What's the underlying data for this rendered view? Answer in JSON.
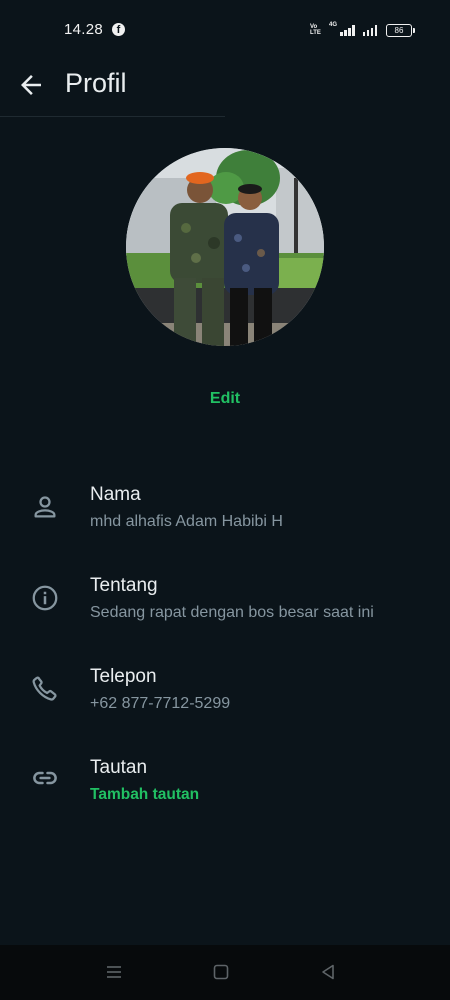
{
  "status_bar": {
    "time": "14.28",
    "network": "4G",
    "volte": "Vo LTE",
    "battery": "86"
  },
  "header": {
    "title": "Profil"
  },
  "profile": {
    "edit_label": "Edit"
  },
  "rows": [
    {
      "icon": "person-icon",
      "label": "Nama",
      "value": "mhd alhafis Adam Habibi H"
    },
    {
      "icon": "info-icon",
      "label": "Tentang",
      "value": "Sedang rapat dengan bos besar saat ini"
    },
    {
      "icon": "phone-icon",
      "label": "Telepon",
      "value": "+62 877-7712-5299"
    },
    {
      "icon": "link-icon",
      "label": "Tautan",
      "value": "Tambah tautan"
    }
  ],
  "colors": {
    "background": "#0b141a",
    "accent": "#21c063",
    "secondary_text": "#8696a0"
  }
}
